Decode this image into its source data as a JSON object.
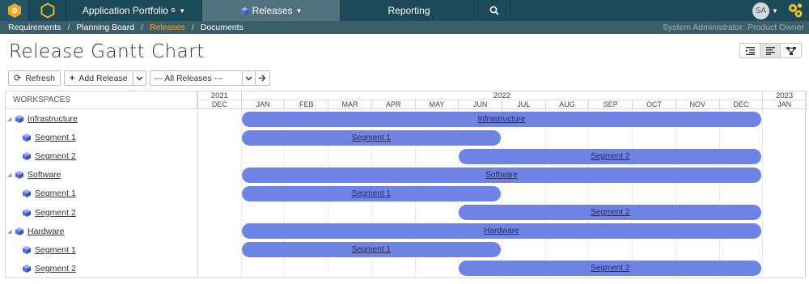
{
  "nav": {
    "portfolio": "Application Portfolio",
    "releases": "Releases",
    "reporting": "Reporting",
    "user_initials": "SA"
  },
  "breadcrumb": {
    "items": [
      "Requirements",
      "Planning Board",
      "Releases",
      "Documents"
    ],
    "active_index": 2,
    "user_info": "System Administrator: Product Owner"
  },
  "page": {
    "title": "Release Gantt Chart"
  },
  "toolbar": {
    "refresh_label": "Refresh",
    "add_release_label": "Add Release",
    "release_filter_value": "--- All Releases ---"
  },
  "gantt": {
    "workspaces_header": "WORKSPACES",
    "years": [
      {
        "label": "2021",
        "span": 1
      },
      {
        "label": "2022",
        "span": 12
      },
      {
        "label": "2023",
        "span": 1
      }
    ],
    "months": [
      "DEC",
      "JAN",
      "FEB",
      "MAR",
      "APR",
      "MAY",
      "JUN",
      "JUL",
      "AUG",
      "SEP",
      "OCT",
      "NOV",
      "DEC",
      "JAN"
    ],
    "rows": [
      {
        "label": "Infrastructure",
        "level": 0,
        "start": 1,
        "end": 13.0
      },
      {
        "label": "Segment 1",
        "level": 1,
        "start": 1,
        "end": 7.0
      },
      {
        "label": "Segment 2",
        "level": 1,
        "start": 6,
        "end": 13.0
      },
      {
        "label": "Software",
        "level": 0,
        "start": 1,
        "end": 13.0
      },
      {
        "label": "Segment 1",
        "level": 1,
        "start": 1,
        "end": 7.0
      },
      {
        "label": "Segment 2",
        "level": 1,
        "start": 6,
        "end": 13.0
      },
      {
        "label": "Hardware",
        "level": 0,
        "start": 1,
        "end": 13.0
      },
      {
        "label": "Segment 1",
        "level": 1,
        "start": 1,
        "end": 7.0
      },
      {
        "label": "Segment 2",
        "level": 1,
        "start": 6,
        "end": 13.0
      }
    ],
    "bar_color": "#6f83e4"
  }
}
